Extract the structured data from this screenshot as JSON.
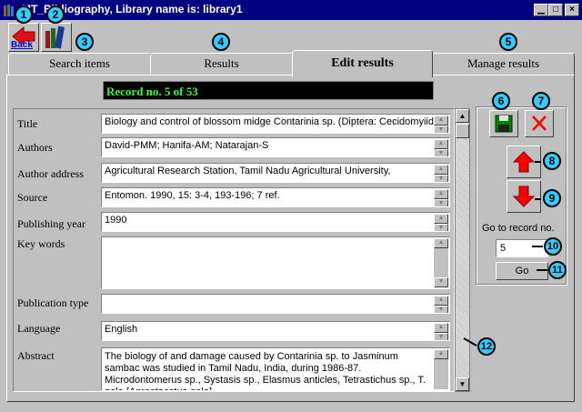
{
  "window": {
    "title": "MT_Bibliography, Library name is: library1"
  },
  "toolbar": {
    "back_label": "Back"
  },
  "tabs": [
    {
      "label": "Search items"
    },
    {
      "label": "Results"
    },
    {
      "label": "Edit results",
      "active": true
    },
    {
      "label": "Manage results"
    }
  ],
  "record_banner": "Record no. 5 of 53",
  "fields": {
    "title": {
      "label": "Title",
      "value": "Biology and control of blossom midge Contarinia sp. (Diptera: Cecidomyiidae)"
    },
    "authors": {
      "label": "Authors",
      "value": "David-PMM; Hanifa-AM; Natarajan-S"
    },
    "address": {
      "label": "Author address",
      "value": "Agricultural Research Station, Tamil Nadu Agricultural University,"
    },
    "source": {
      "label": "Source",
      "value": "Entomon. 1990, 15: 3-4, 193-196; 7 ref."
    },
    "year": {
      "label": "Publishing year",
      "value": "1990"
    },
    "keywords": {
      "label": "Key words",
      "value": ""
    },
    "pubtype": {
      "label": "Publication type",
      "value": ""
    },
    "language": {
      "label": "Language",
      "value": "English"
    },
    "abstract": {
      "label": "Abstract",
      "value": "The biology of and damage caused by Contarinia sp. to Jasminum sambac was studied in Tamil Nadu, India, during 1986-87. Microdontomerus sp., Systasis sp., Elasmus anticles, Tetrastichus sp., T. gala [Aprostocetus gala]"
    }
  },
  "side_panel": {
    "goto_label": "Go to record no.",
    "goto_value": "5",
    "go_button": "Go"
  },
  "callouts": [
    "1",
    "2",
    "3",
    "4",
    "5",
    "6",
    "7",
    "8",
    "9",
    "10",
    "11",
    "12"
  ],
  "colors": {
    "title_bar": "#000080",
    "banner_bg": "#000000",
    "banner_text": "#33ff33",
    "callout": "#33ccff",
    "arrow_red": "#ff0000"
  }
}
